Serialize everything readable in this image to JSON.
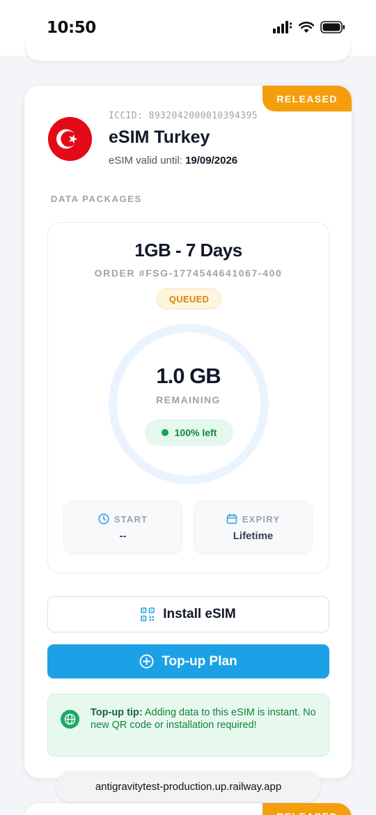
{
  "status_bar": {
    "time": "10:50",
    "icons": [
      "cellular-signal-icon",
      "wifi-icon",
      "battery-icon"
    ]
  },
  "card": {
    "badge": "RELEASED",
    "flag_icon": "turkey-flag-icon",
    "iccid": "ICCID: 8932042000010394395",
    "title": "eSIM Turkey",
    "valid_label": "eSIM valid until:",
    "valid_date": "19/09/2026",
    "section_label": "DATA PACKAGES",
    "package": {
      "title": "1GB - 7 Days",
      "order": "ORDER #FSG-1774544641067-400",
      "status": "QUEUED",
      "remaining_value": "1.0 GB",
      "remaining_label": "REMAINING",
      "left_text": "100% left",
      "left_fraction": 1.0,
      "start_label": "START",
      "start_value": "--",
      "expiry_label": "EXPIRY",
      "expiry_value": "Lifetime"
    },
    "install_label": "Install eSIM",
    "topup_label": "Top-up Plan",
    "tip_bold": "Top-up tip:",
    "tip_text": "Adding data to this eSIM is instant. No new QR code or installation required!"
  },
  "next_card": {
    "badge": "RELEASED"
  },
  "url_bar": {
    "url": "antigravitytest-production.up.railway.app"
  },
  "colors": {
    "released": "#f59e0b",
    "primary": "#1da1e6",
    "queued_text": "#d48806",
    "success": "#16a34a",
    "tip_bg": "#e7f9ef"
  }
}
